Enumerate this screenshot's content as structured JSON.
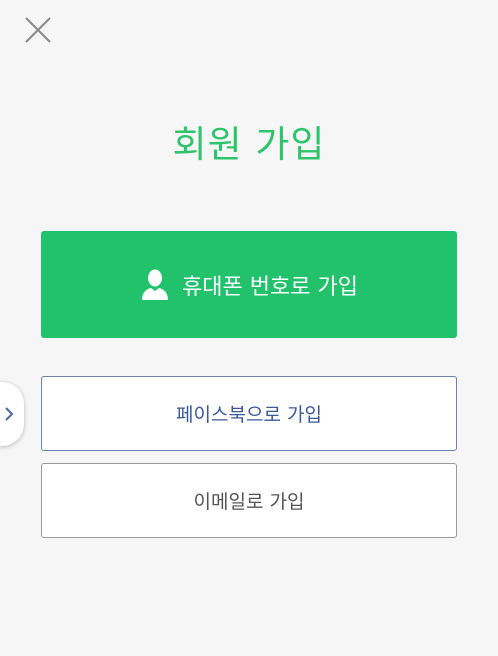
{
  "header": {
    "close_icon": "close-icon"
  },
  "title": "회원 가입",
  "buttons": {
    "phone_label": "휴대폰 번호로 가입",
    "phone_icon": "person-icon",
    "facebook_label": "페이스북으로 가입",
    "email_label": "이메일로 가입"
  },
  "side_handle": {
    "icon": "chevron-right-icon"
  },
  "colors": {
    "accent_green": "#22c26c",
    "title_green": "#2fc46b",
    "facebook_blue": "#3b5998",
    "background": "#f6f6f6"
  }
}
